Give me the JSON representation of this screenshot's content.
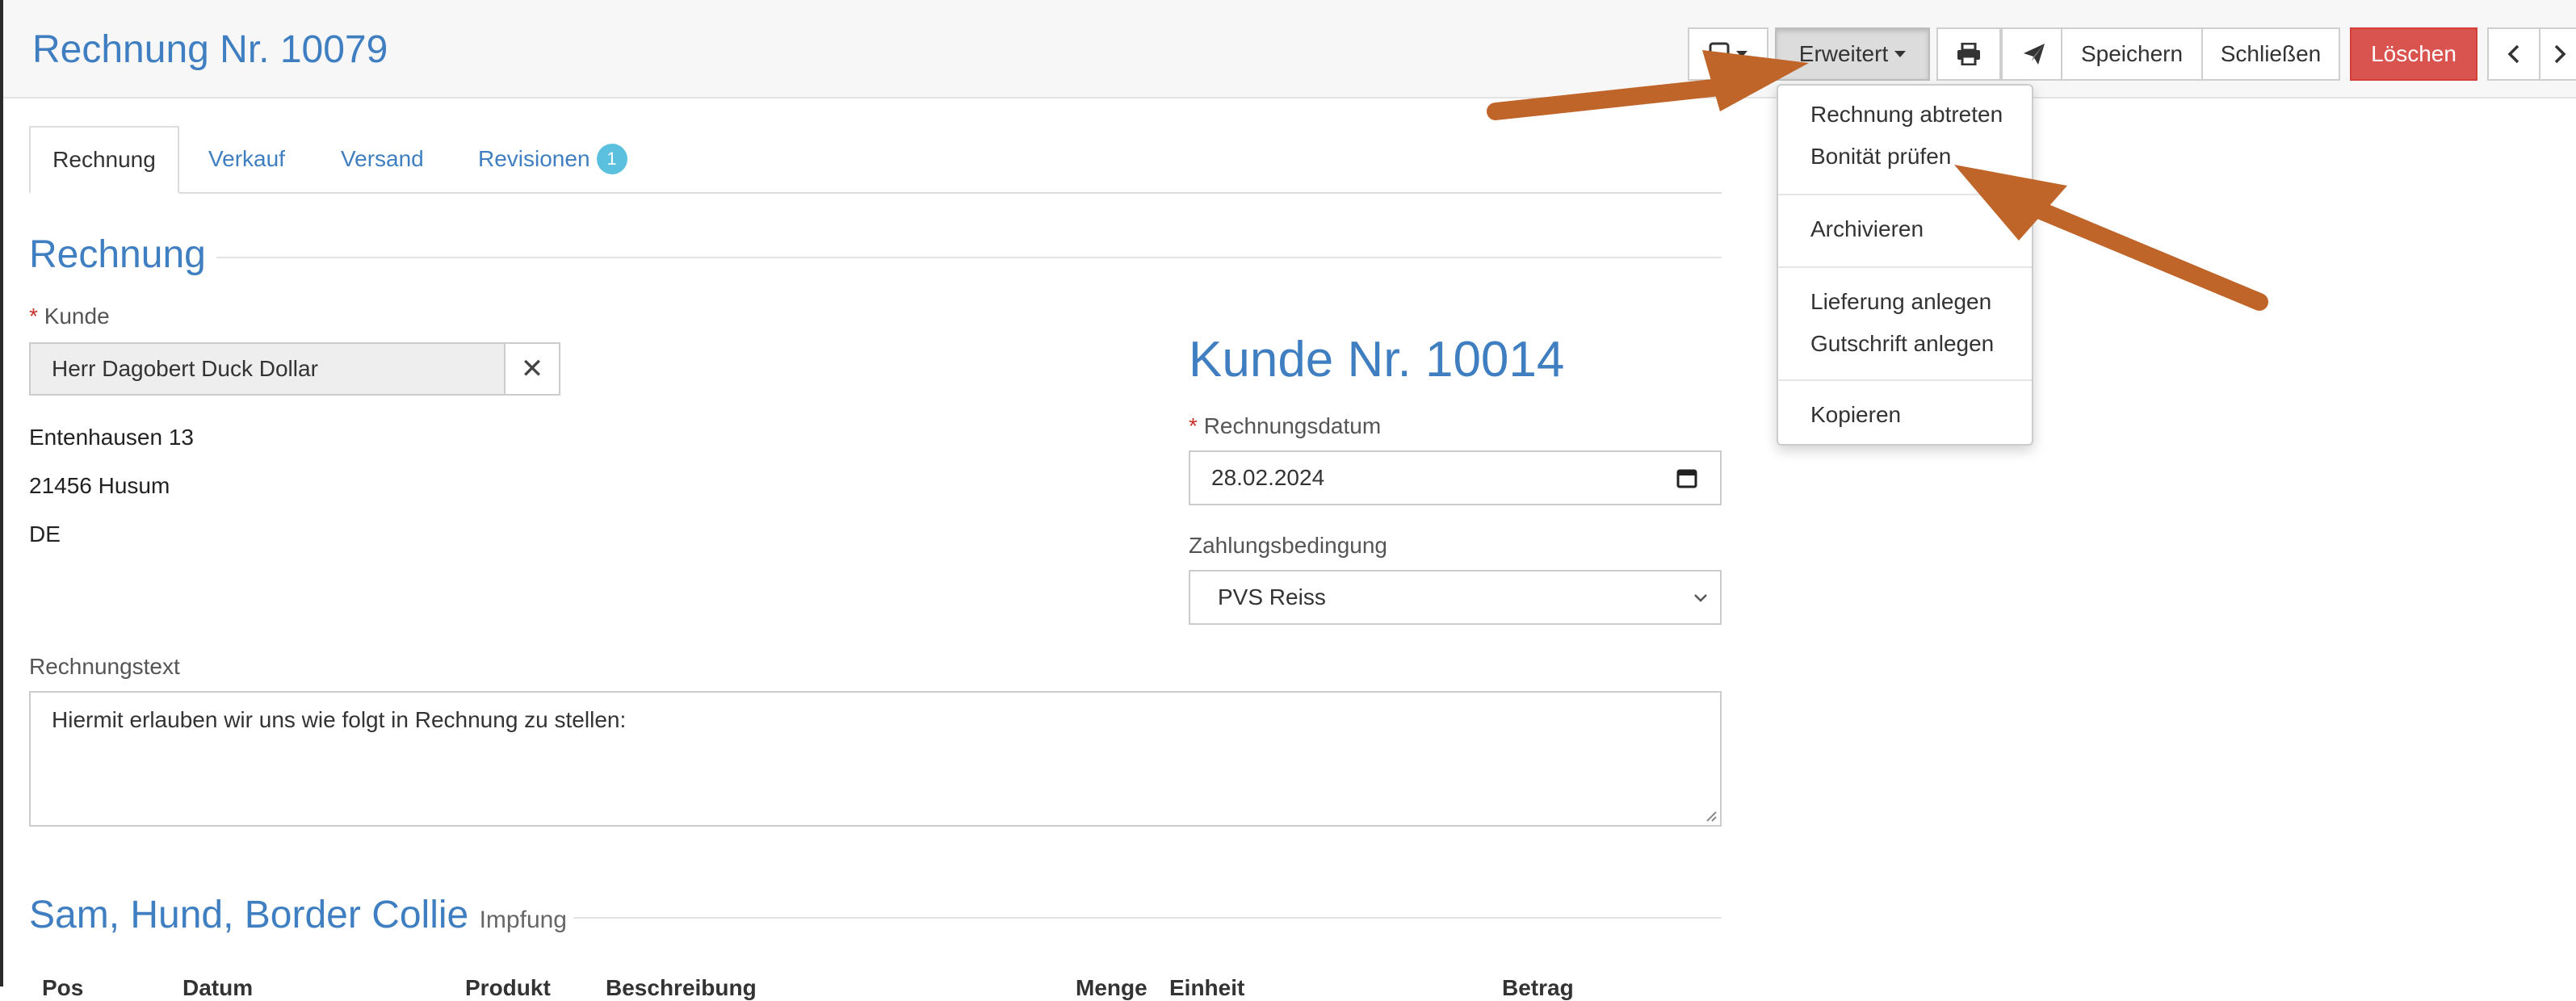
{
  "header": {
    "title": "Rechnung Nr. 10079"
  },
  "toolbar": {
    "erweitert_label": "Erweitert",
    "save_label": "Speichern",
    "close_label": "Schließen",
    "delete_label": "Löschen"
  },
  "tabs": [
    {
      "label": "Rechnung"
    },
    {
      "label": "Verkauf"
    },
    {
      "label": "Versand"
    },
    {
      "label": "Revisionen",
      "badge": "1"
    }
  ],
  "dropdown": {
    "items": [
      "Rechnung abtreten",
      "Bonität prüfen",
      "Archivieren",
      "Lieferung anlegen",
      "Gutschrift anlegen",
      "Kopieren"
    ]
  },
  "form": {
    "section_title": "Rechnung",
    "customer_label": "Kunde",
    "customer_value": "Herr Dagobert Duck Dollar",
    "address": [
      "Entenhausen 13",
      "21456 Husum",
      "DE"
    ],
    "customer_number": "Kunde Nr. 10014",
    "date_label": "Rechnungsdatum",
    "date_value": "28.02.2024",
    "payment_label": "Zahlungsbedingung",
    "payment_value": "PVS Reiss",
    "text_label": "Rechnungstext",
    "text_value": "Hiermit erlauben wir uns wie folgt in Rechnung zu stellen:"
  },
  "patient_section": {
    "title": "Sam, Hund, Border Collie",
    "subtitle": "Impfung"
  },
  "table_headers": [
    "Pos",
    "Datum",
    "Produkt",
    "Beschreibung",
    "Menge",
    "Einheit",
    "Betrag"
  ],
  "colors": {
    "accent": "#3f7fc1",
    "danger": "#d9534f",
    "badge": "#5bc0de",
    "arrow": "#c0652a"
  }
}
